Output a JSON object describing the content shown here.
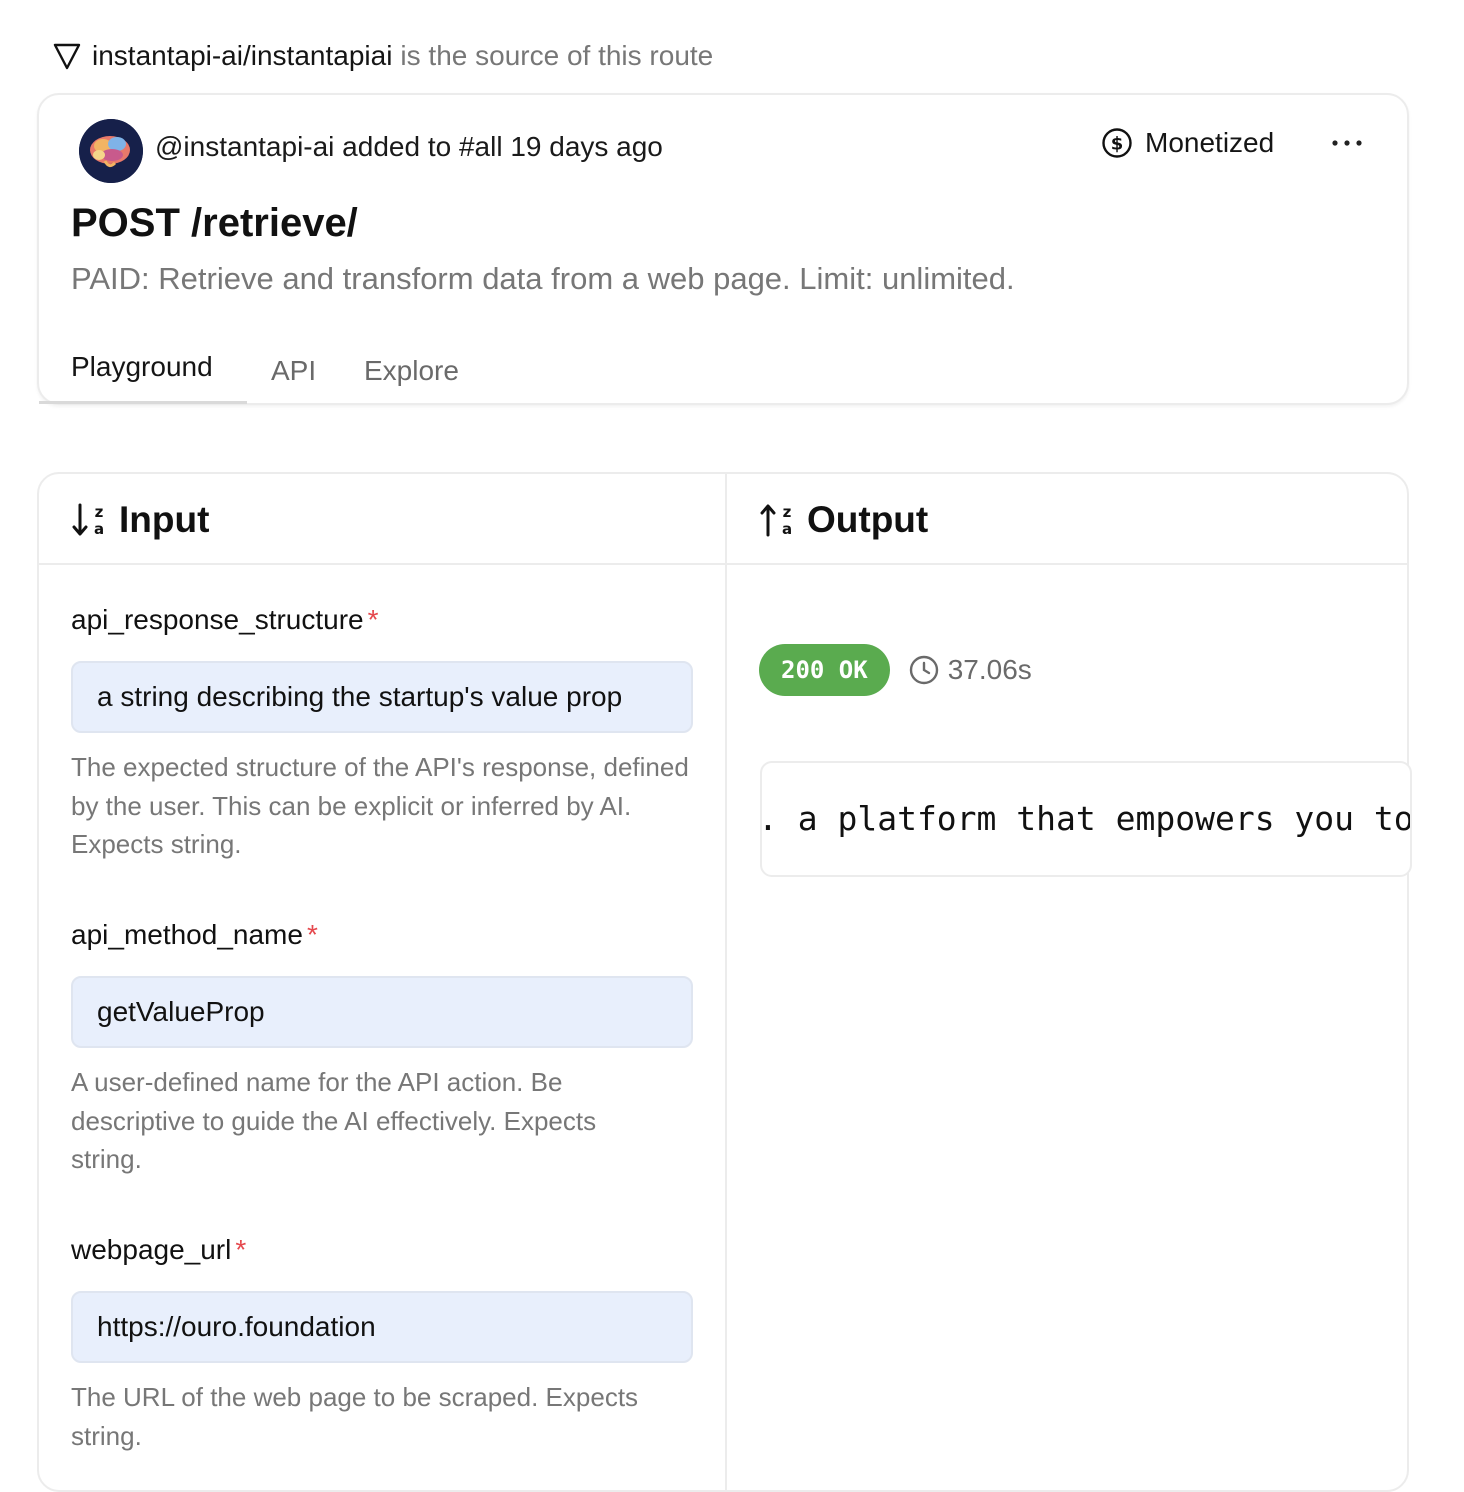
{
  "source": {
    "repo": "instantapi-ai/instantapiai",
    "suffix": "is the source of this route"
  },
  "route": {
    "added_by": "@instantapi-ai added to #all 19 days ago",
    "monetized_label": "Monetized",
    "title": "POST /retrieve/",
    "description": "PAID: Retrieve and transform data from a web page. Limit: unlimited.",
    "tabs": [
      {
        "label": "Playground",
        "active": true
      },
      {
        "label": "API",
        "active": false
      },
      {
        "label": "Explore",
        "active": false
      }
    ]
  },
  "input": {
    "heading": "Input",
    "fields": [
      {
        "name": "api_response_structure",
        "required_mark": "*",
        "value": "a string describing the startup's value prop",
        "help": "The expected structure of the API's response, defined by the user. This can be explicit or inferred by AI. Expects string."
      },
      {
        "name": "api_method_name",
        "required_mark": "*",
        "value": "getValueProp",
        "help": "A user-defined name for the API action. Be descriptive to guide the AI effectively. Expects string."
      },
      {
        "name": "webpage_url",
        "required_mark": "*",
        "value": "https://ouro.foundation",
        "help": "The URL of the web page to be scraped. Expects string."
      }
    ]
  },
  "output": {
    "heading": "Output",
    "status": "200 OK",
    "duration": "37.06s",
    "text": ". a platform that empowers you to e"
  },
  "colors": {
    "status_green": "#5aab4f",
    "input_bg": "#e8effc",
    "required_red": "#e5484d",
    "muted_text": "#777777"
  },
  "icons": [
    "triangle-down-icon",
    "avatar-brain-icon",
    "dollar-circle-icon",
    "more-horizontal-icon",
    "sort-down-az-icon",
    "sort-up-az-icon",
    "clock-icon"
  ]
}
